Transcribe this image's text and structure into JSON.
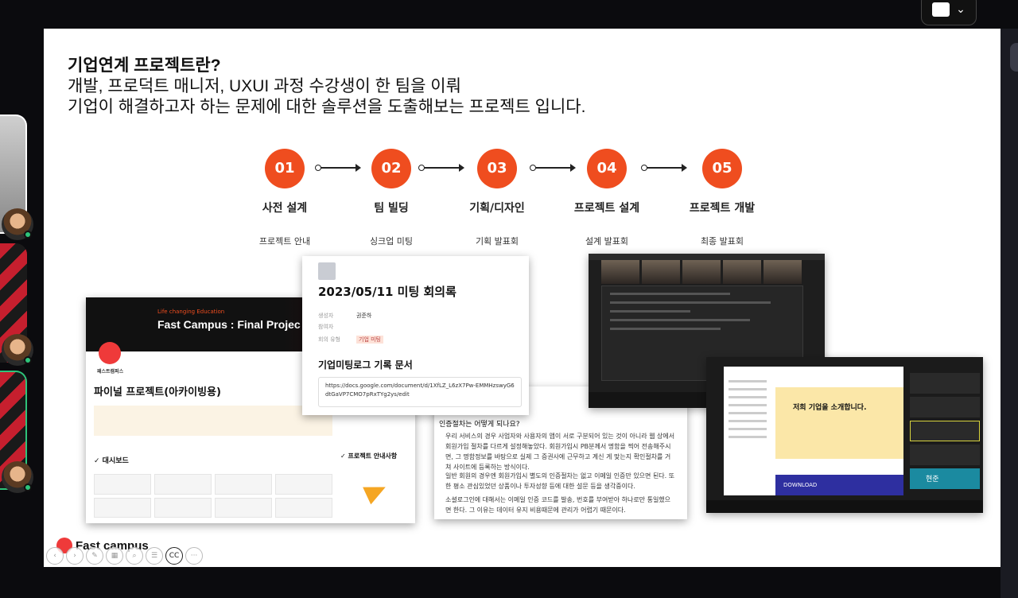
{
  "slide": {
    "title": "기업연계 프로젝트란?",
    "line1": "개발, 프로덕트 매니저, UXUI 과정 수강생이 한 팀을 이뤄",
    "line2": "기업이 해결하고자 하는 문제에 대한 솔루션을 도출해보는 프로젝트 입니다.",
    "accent_color": "#ef4d1f",
    "steps": [
      {
        "num": "01",
        "name": "사전 설계",
        "sub": "프로젝트 안내"
      },
      {
        "num": "02",
        "name": "팀 빌딩",
        "sub": "싱크업 미팅"
      },
      {
        "num": "03",
        "name": "기획/디자인",
        "sub": "기획 발표회"
      },
      {
        "num": "04",
        "name": "프로젝트 설계",
        "sub": "설계 발표회"
      },
      {
        "num": "05",
        "name": "프로젝트 개발",
        "sub": "최종 발표회"
      }
    ],
    "archive": {
      "slogan": "Life changing Education",
      "banner_title": "Fast Campus : Final Projec",
      "brand_ko": "패스트캠퍼스",
      "page_title": "파이널 프로젝트(아카이빙용)",
      "dashboard": "✓ 대시보드",
      "side_title": "✓ 프로젝트 안내사항"
    },
    "minutes": {
      "title": "2023/05/11 미팅 회의록",
      "props": [
        {
          "label": "생성자",
          "value": "권준하"
        },
        {
          "label": "참여자",
          "value": ""
        },
        {
          "label": "회의 유형",
          "value": "기업 미팅"
        }
      ],
      "heading": "기업미팅로그 기록 문서",
      "link": "https://docs.google.com/document/d/1XfLZ_L6zX7Pw-EMMHzswyG6dtGaVP7CMO7pRxTYg2ys/edit"
    },
    "qa": {
      "question": "인증절차는 어떻게 되나요?",
      "a1": "우리 서비스의 경우 사업자와 사용자의 앱이 서로 구분되어 있는 것이 아니라 웹 상에서 회원가입 절차를 다르게 설정해놓았다. 회원가입시 PB분께서 명함을 찍어 전송해주시면, 그 명함정보를 바탕으로 실제 그 증권사에 근무하고 계신 게 맞는지 확인절차를 거쳐 사이트에 등록하는 방식이다.",
      "a2": "일반 회원의 경우엔 회원가입시 별도의 인증절차는 없고 이메일 인증만 있으면 된다. 또한 평소 관심있었던 상품이나 투자성향 등에 대한 설문 등을 생각중이다.",
      "a3": "소셜로그인에 대해서는 이메일 인증 코드를 발송, 번호를 부여받아 하나로만 통일했으면 한다. 그 이유는 데이터 유지 비용때문에 관리가 어렵기 때문이다."
    },
    "zoom2": {
      "headline": "저희 기업을 소개합니다.",
      "download": "DOWNLOAD",
      "participant": "현준"
    },
    "logo_text": "Fast campus"
  },
  "controls": [
    "prev-icon",
    "next-icon",
    "pen-icon",
    "grid-icon",
    "zoom-icon",
    "menu-icon",
    "captions-icon",
    "more-icon"
  ],
  "controls_labels": {
    "captions": "CC",
    "more": "···"
  }
}
